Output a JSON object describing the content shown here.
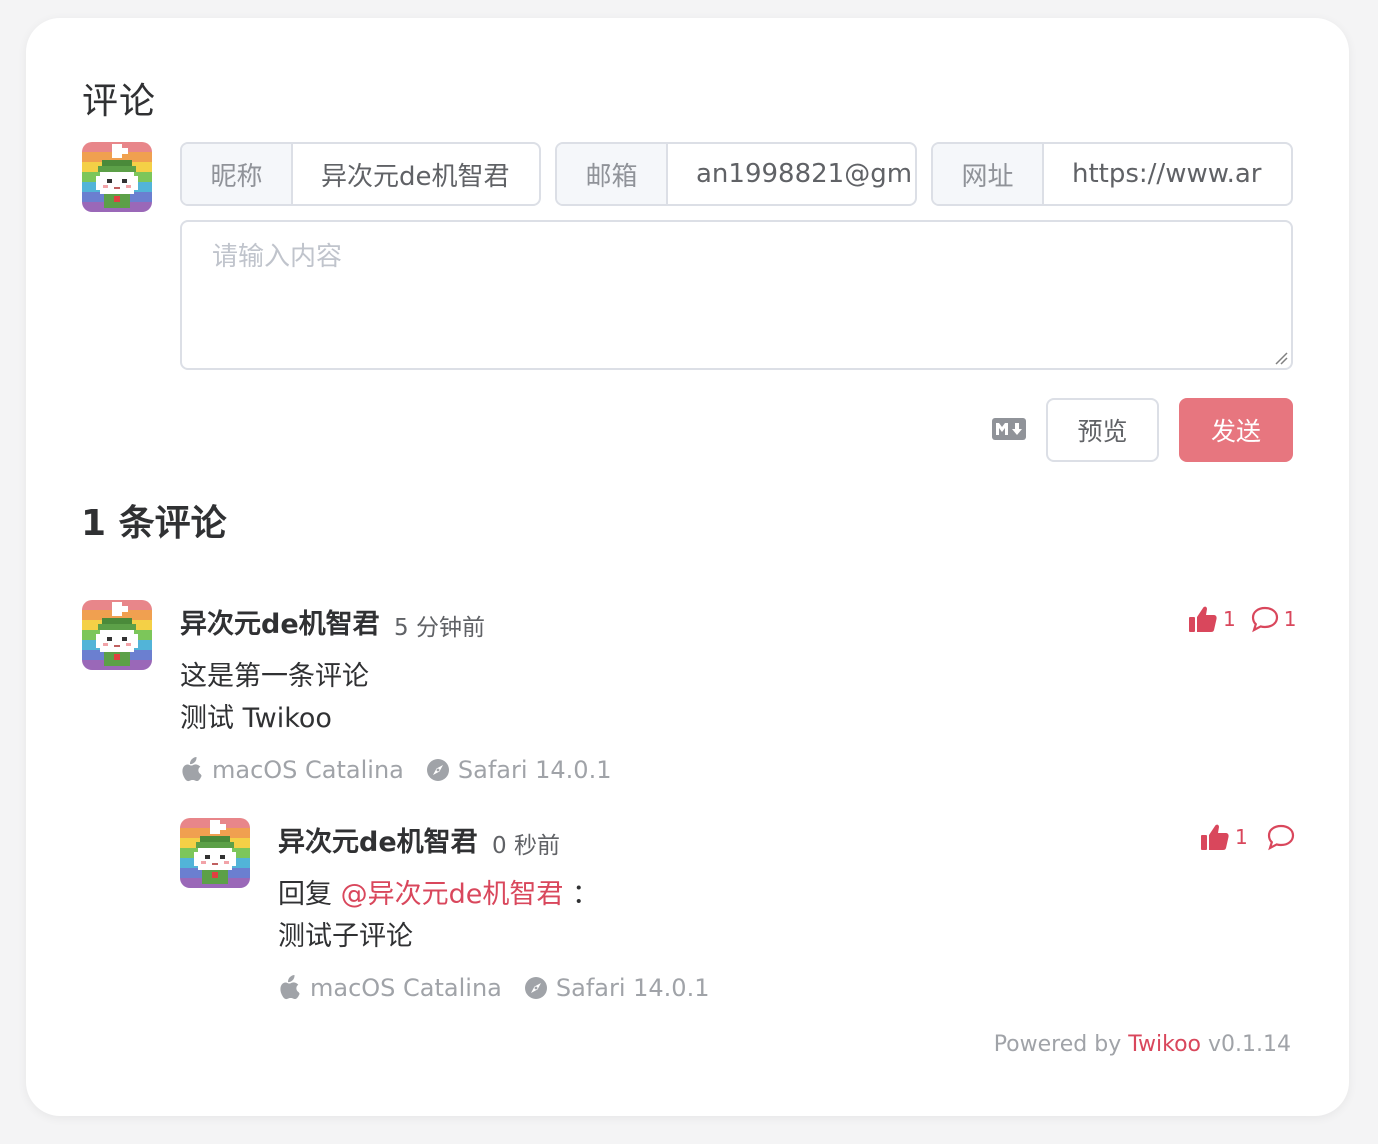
{
  "form": {
    "title": "评论",
    "nick_label": "昵称",
    "nick_value": "异次元de机智君",
    "mail_label": "邮箱",
    "mail_value": "an1998821@gm",
    "link_label": "网址",
    "link_value": "https://www.ar",
    "textarea_placeholder": "请输入内容",
    "preview_label": "预览",
    "send_label": "发送"
  },
  "comment_count": "1 条评论",
  "comments": [
    {
      "nick": "异次元de机智君",
      "time": "5 分钟前",
      "lines": [
        "这是第一条评论",
        "测试 Twikoo"
      ],
      "os": "macOS Catalina",
      "browser": "Safari 14.0.1",
      "likes": "1",
      "replies": "1",
      "children": [
        {
          "nick": "异次元de机智君",
          "time": "0 秒前",
          "reply_prefix": "回复",
          "reply_to": "@异次元de机智君",
          "reply_suffix": "：",
          "text": "测试子评论",
          "os": "macOS Catalina",
          "browser": "Safari 14.0.1",
          "likes": "1"
        }
      ]
    }
  ],
  "footer": {
    "prefix": "Powered by",
    "brand": "Twikoo",
    "version": "v0.1.14"
  },
  "colors": {
    "accent": "#d9475c",
    "send_button": "#e7767f"
  },
  "icons": [
    "markdown-icon",
    "apple-icon",
    "safari-compass-icon",
    "thumbs-up-icon",
    "comment-bubble-icon"
  ]
}
